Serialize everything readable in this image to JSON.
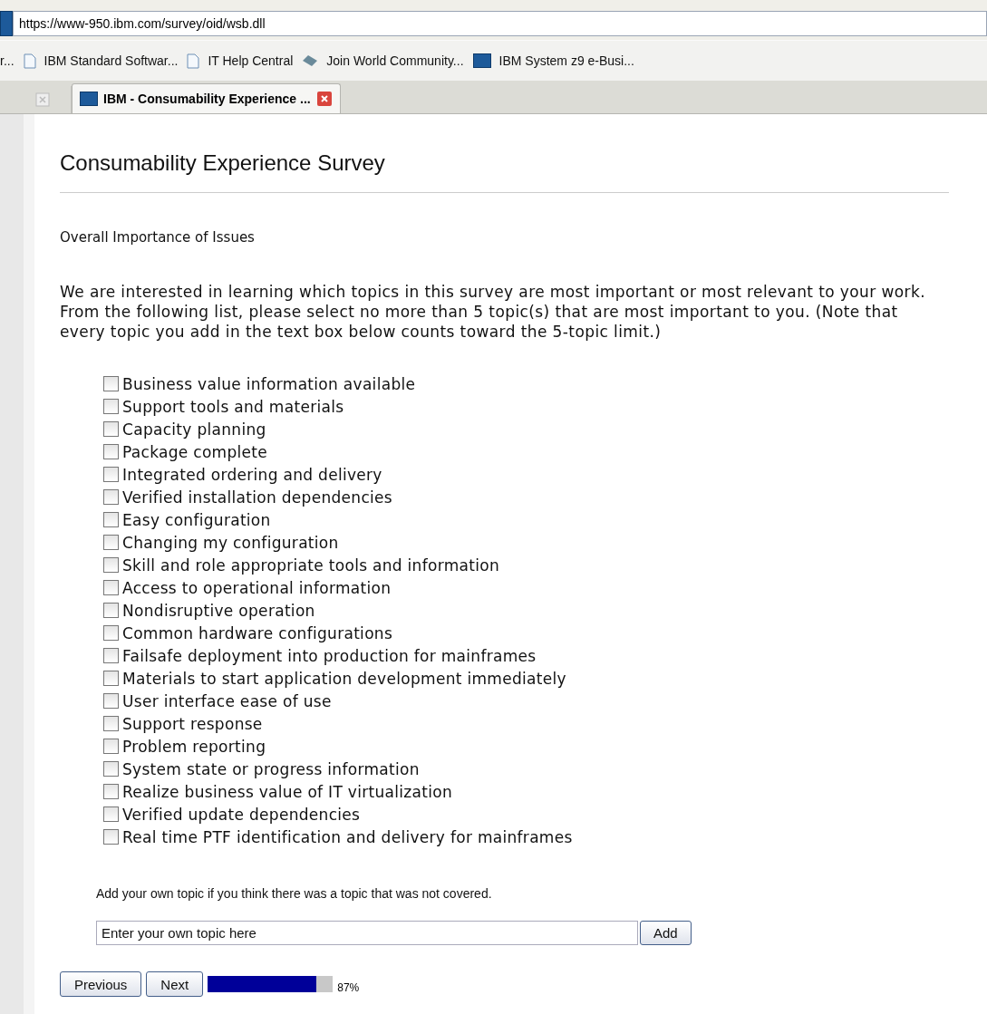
{
  "browser": {
    "address": "https://www-950.ibm.com/survey/oid/wsb.dll",
    "bookmarks": [
      {
        "label": "r...",
        "kind": "none"
      },
      {
        "label": "IBM Standard Softwar...",
        "kind": "page"
      },
      {
        "label": "IT Help Central",
        "kind": "page"
      },
      {
        "label": "Join World Community...",
        "kind": "diamond"
      },
      {
        "label": "IBM System z9 e-Busi...",
        "kind": "ibm"
      }
    ],
    "tabs": [
      {
        "selected": false
      },
      {
        "label": "IBM - Consumability Experience ...",
        "selected": true
      }
    ]
  },
  "survey": {
    "title": "Consumability Experience Survey",
    "section": "Overall Importance of Issues",
    "intro": "We are interested in learning which topics in this survey are most important or most relevant to your work. From the following list, please select no more than 5 topic(s) that are most important to you. (Note that every topic you add in the text box below counts toward the 5-topic limit.)",
    "topics": [
      {
        "label": "Business value information available",
        "checked": false
      },
      {
        "label": "Support tools and materials",
        "checked": false
      },
      {
        "label": "Capacity planning",
        "checked": false
      },
      {
        "label": "Package complete",
        "checked": false
      },
      {
        "label": "Integrated ordering and delivery",
        "checked": false
      },
      {
        "label": "Verified installation dependencies",
        "checked": false
      },
      {
        "label": "Easy configuration",
        "checked": false
      },
      {
        "label": "Changing my configuration",
        "checked": false
      },
      {
        "label": "Skill and role appropriate tools and information",
        "checked": false
      },
      {
        "label": "Access to operational information",
        "checked": false
      },
      {
        "label": "Nondisruptive operation",
        "checked": false
      },
      {
        "label": "Common hardware configurations",
        "checked": false
      },
      {
        "label": "Failsafe deployment into production for mainframes",
        "checked": false
      },
      {
        "label": "Materials to start application development immediately",
        "checked": false
      },
      {
        "label": "User interface ease of use",
        "checked": false
      },
      {
        "label": "Support response",
        "checked": false
      },
      {
        "label": "Problem reporting",
        "checked": false
      },
      {
        "label": "System state or progress information",
        "checked": false
      },
      {
        "label": "Realize business value of IT virtualization",
        "checked": false
      },
      {
        "label": "Verified update dependencies",
        "checked": false
      },
      {
        "label": "Real time PTF identification and delivery for mainframes",
        "checked": false
      }
    ],
    "own_topic_prompt": "Add your own topic if you think there was a topic that was not covered.",
    "own_topic_value": "Enter your own topic here",
    "add_button": "Add",
    "previous_button": "Previous",
    "next_button": "Next",
    "progress": {
      "level": 0.87,
      "reading": "87%"
    }
  }
}
